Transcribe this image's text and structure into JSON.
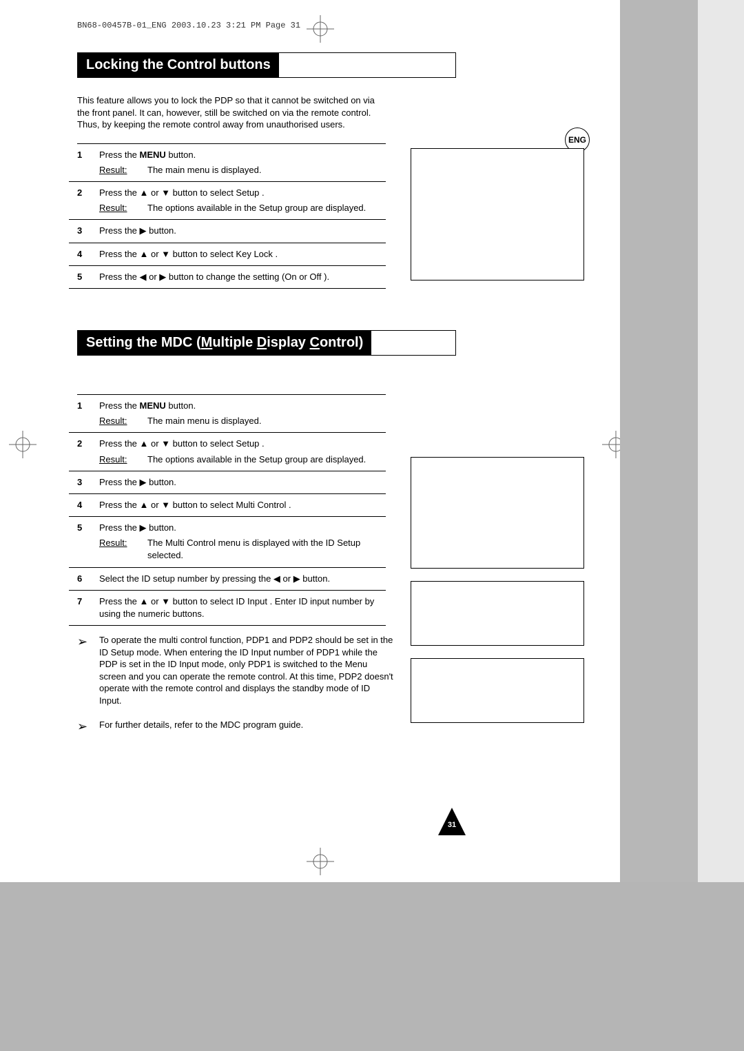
{
  "meta_line": "BN68-00457B-01_ENG  2003.10.23  3:21 PM  Page 31",
  "eng_badge": "ENG",
  "page_number": "31",
  "section1": {
    "title": "Locking the Control buttons",
    "intro": "This feature allows you to lock the PDP so that it cannot be switched on via the front panel. It can, however, still be switched on via the remote control. Thus, by keeping the remote control away from unauthorised users.",
    "steps": [
      {
        "n": "1",
        "text_pre": "Press the ",
        "bold": "MENU",
        "text_post": " button.",
        "result": "The main menu is displayed."
      },
      {
        "n": "2",
        "text": "Press the ▲ or ▼ button to select Setup .",
        "result": "The options available in the Setup  group are displayed."
      },
      {
        "n": "3",
        "text": "Press the ▶ button."
      },
      {
        "n": "4",
        "text": "Press the ▲ or ▼ button to select Key Lock ."
      },
      {
        "n": "5",
        "text": "Press the ◀ or ▶ button to change the setting (On or Off )."
      }
    ]
  },
  "section2": {
    "title_parts": {
      "pre": "Setting the MDC (",
      "m": "M",
      "mid1": "ultiple ",
      "d": "D",
      "mid2": "isplay ",
      "c": "C",
      "post": "ontrol)"
    },
    "steps": [
      {
        "n": "1",
        "text_pre": "Press the ",
        "bold": "MENU",
        "text_post": " button.",
        "result": "The main menu is displayed."
      },
      {
        "n": "2",
        "text": "Press the ▲ or ▼ button to select Setup .",
        "result": "The options available in the Setup  group are displayed."
      },
      {
        "n": "3",
        "text": "Press the ▶ button."
      },
      {
        "n": "4",
        "text": "Press the ▲ or ▼ button to select Multi Control ."
      },
      {
        "n": "5",
        "text": "Press the ▶ button.",
        "result": "The Multi Control  menu is displayed with the ID Setup  selected."
      },
      {
        "n": "6",
        "text": "Select the ID setup number by pressing the ◀ or ▶ button."
      },
      {
        "n": "7",
        "text": "Press the ▲ or ▼ button to select ID Input . Enter ID input number by using the numeric buttons."
      }
    ],
    "notes": [
      "To operate the multi control function, PDP1 and PDP2 should be set in the ID Setup mode. When entering the ID Input number of PDP1 while the PDP is set in the ID Input mode, only PDP1 is switched to the Menu screen and you can operate the remote control. At this time, PDP2 doesn't operate with the remote control and displays the standby mode of ID Input.",
      "For further details, refer to the MDC program guide."
    ]
  },
  "labels": {
    "result": "Result:"
  }
}
